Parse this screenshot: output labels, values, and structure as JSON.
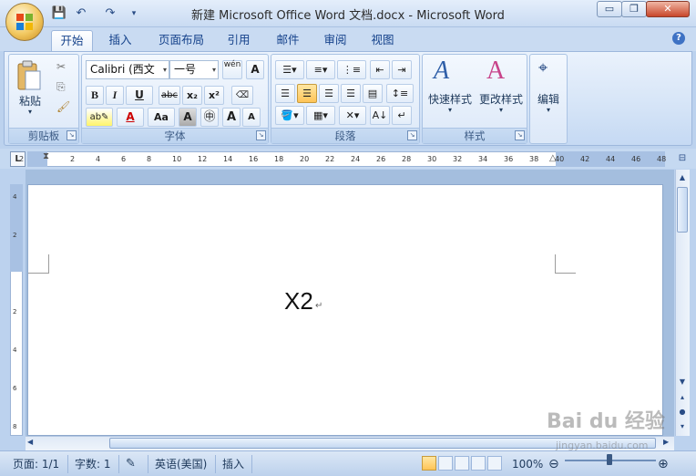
{
  "window": {
    "title": "新建 Microsoft Office Word 文档.docx - Microsoft Word",
    "minimize": "▭",
    "restore": "❐",
    "close": "✕"
  },
  "qat": {
    "save": "💾",
    "undo": "↶",
    "redo": "↷",
    "more": "▾"
  },
  "tabs": [
    "开始",
    "插入",
    "页面布局",
    "引用",
    "邮件",
    "审阅",
    "视图"
  ],
  "ribbon": {
    "clipboard": {
      "label": "剪贴板",
      "paste": "粘贴"
    },
    "font": {
      "label": "字体",
      "font_name": "Calibri (西文",
      "font_size": "一号",
      "bold": "B",
      "italic": "I",
      "underline": "U",
      "strike": "abc",
      "sub": "x₂",
      "sup": "x²",
      "grow": "A",
      "shrink": "A",
      "aa": "Aa",
      "wen": "wén"
    },
    "paragraph": {
      "label": "段落"
    },
    "styles": {
      "label": "样式",
      "quick_styles": "快速样式",
      "change_styles": "更改样式"
    },
    "editing": {
      "label": "编辑"
    }
  },
  "ruler": {
    "h_ticks": [
      "2",
      "",
      "2",
      "4",
      "6",
      "8",
      "10",
      "12",
      "14",
      "16",
      "18",
      "20",
      "22",
      "24",
      "26",
      "28",
      "30",
      "32",
      "34",
      "36",
      "38",
      "40",
      "42",
      "44",
      "46",
      "48"
    ],
    "v_ticks": [
      "4",
      "2",
      "",
      "2",
      "4",
      "6",
      "8"
    ]
  },
  "document": {
    "text": "X2",
    "para_mark": "↵"
  },
  "status": {
    "page": "页面: 1/1",
    "words": "字数: 1",
    "language": "英语(美国)",
    "mode": "插入",
    "zoom": "100%"
  },
  "watermark": {
    "main": "Bai du 经验",
    "sub": "jingyan.baidu.com"
  },
  "colors": {
    "accent": "#15428b",
    "ribbon": "#d5e4f7",
    "selected": "#ffc457"
  }
}
